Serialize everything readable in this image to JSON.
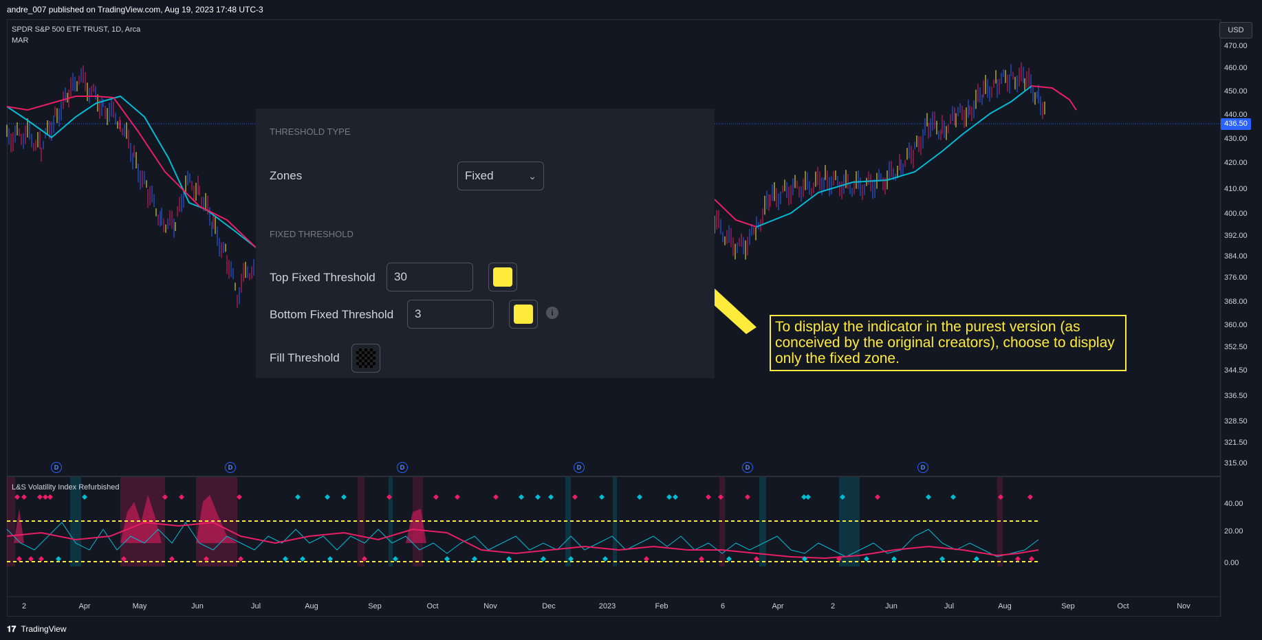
{
  "header": {
    "published_text": "andre_007 published on TradingView.com, Aug 19, 2023 17:48 UTC-3"
  },
  "symbol": {
    "name": "SPDR S&P 500 ETF TRUST, 1D, Arca",
    "overlay": "MAR"
  },
  "price_scale": {
    "currency_button": "USD",
    "current_price": "436.50",
    "ticks": [
      "470.00",
      "460.00",
      "450.00",
      "440.00",
      "430.00",
      "420.00",
      "410.00",
      "400.00",
      "392.00",
      "384.00",
      "376.00",
      "368.00",
      "360.00",
      "352.50",
      "344.50",
      "336.50",
      "328.50",
      "321.50",
      "315.00"
    ]
  },
  "indicator": {
    "title": "L&S Volatility Index Refurbished",
    "ticks": [
      "40.00",
      "20.00",
      "0.00"
    ]
  },
  "time_axis": {
    "labels": [
      "2",
      "Apr",
      "May",
      "Jun",
      "Jul",
      "Aug",
      "Sep",
      "Oct",
      "Nov",
      "Dec",
      "2023",
      "Feb",
      "6",
      "Apr",
      "2",
      "Jun",
      "Jul",
      "Aug",
      "Sep",
      "Oct",
      "Nov"
    ]
  },
  "dividend_markers": [
    "D",
    "D",
    "D",
    "D",
    "D",
    "D"
  ],
  "settings": {
    "section_threshold_type": "THRESHOLD TYPE",
    "zones_label": "Zones",
    "zones_value": "Fixed",
    "section_fixed_threshold": "FIXED THRESHOLD",
    "top_label": "Top Fixed Threshold",
    "top_value": "30",
    "bottom_label": "Bottom Fixed Threshold",
    "bottom_value": "3",
    "fill_label": "Fill Threshold",
    "info_glyph": "i"
  },
  "annotation": {
    "text": "To display the indicator in the purest version (as conceived by the original creators), choose to display only the fixed zone."
  },
  "footer": {
    "brand": "TradingView",
    "logo_glyph": "𝟏𝟕"
  },
  "colors": {
    "background": "#131722",
    "panel": "#1e222d",
    "up_bar": "#2962ff",
    "down_bar": "#e91e63",
    "ma_up": "#00bcd4",
    "ma_down": "#e91e63",
    "threshold": "#ffeb3b",
    "accent": "#2962ff"
  }
}
